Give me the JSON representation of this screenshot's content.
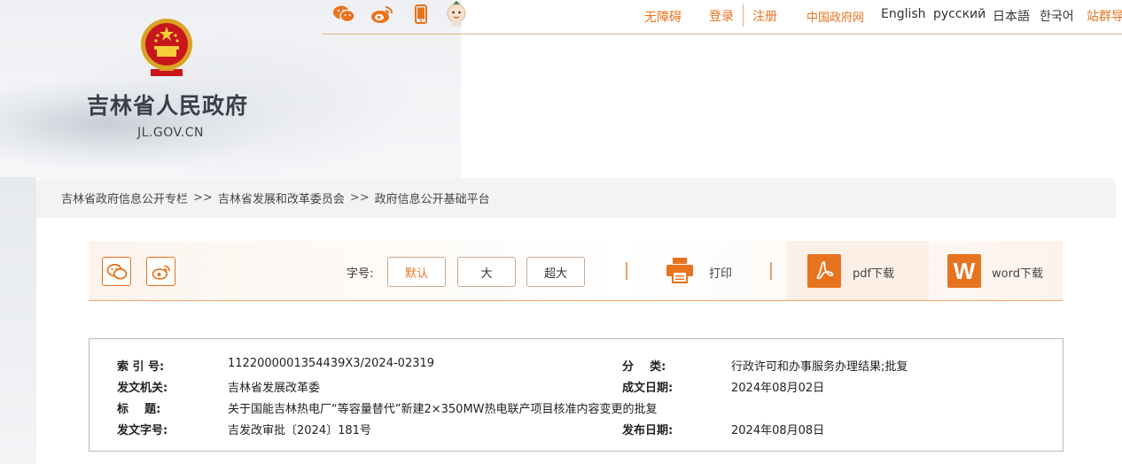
{
  "header": {
    "social_icons": [
      "wechat-icon",
      "weibo-icon",
      "mobile-icon",
      "mascot-icon"
    ],
    "links": {
      "accessibility": "无障碍",
      "login": "登录",
      "register": "注册",
      "gov_portal": "中国政府网",
      "english": "English",
      "russian": "русский",
      "japanese": "日本語",
      "korean": "한국어",
      "site_group": "站群导"
    }
  },
  "logo": {
    "title": "吉林省人民政府",
    "domain": "JL.GOV.CN"
  },
  "breadcrumb": [
    "吉林省政府信息公开专栏",
    "吉林省发展和改革委员会",
    "政府信息公开基础平台"
  ],
  "breadcrumb_separator": ">>",
  "toolbar": {
    "font_size_label": "字号:",
    "font_options": [
      "默认",
      "大",
      "超大"
    ],
    "selected_font": "默认",
    "print_label": "打印",
    "pdf_label": "pdf下载",
    "word_label": "word下载",
    "word_icon_letter": "W"
  },
  "info": {
    "index_no_label": "索 引 号:",
    "index_no": "1122000001354439X3/2024-02319",
    "category_label": "分    类:",
    "category": "行政许可和办事服务办理结果;批复",
    "issuer_label": "发文机关:",
    "issuer": "吉林省发展改革委",
    "created_label": "成文日期:",
    "created_date": "2024年08月02日",
    "title_label": "标    题:",
    "title": "关于国能吉林热电厂“等容量替代”新建2×350MW热电联产项目核准内容变更的批复",
    "doc_no_label": "发文字号:",
    "doc_no": "吉发改审批〔2024〕181号",
    "published_label": "发布日期:",
    "published_date": "2024年08月08日"
  },
  "colors": {
    "accent": "#e8731e",
    "breadcrumb_bg": "#f3f3f3",
    "border": "#b9b9b9"
  }
}
